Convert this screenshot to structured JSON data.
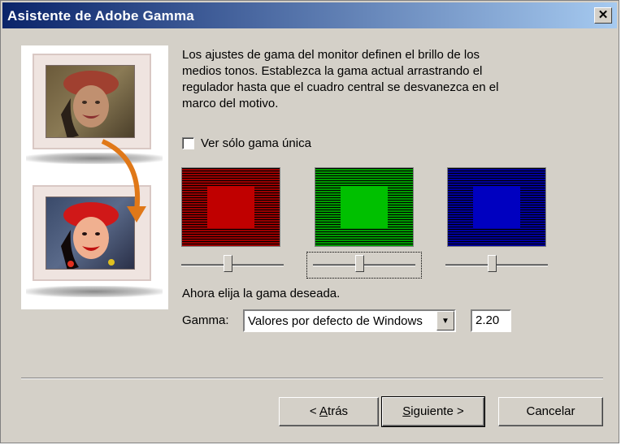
{
  "window": {
    "title": "Asistente de Adobe Gamma",
    "close_glyph": "✕"
  },
  "description": "Los ajustes de gama del monitor definen el brillo de los medios tonos. Establezca la gama actual arrastrando el regulador hasta que el cuadro central se desvanezca en el marco del motivo.",
  "single_gamma_checkbox": {
    "label": "Ver sólo gama única",
    "checked": false
  },
  "swatches": [
    {
      "name": "red",
      "frame_color": "#9a0000",
      "center_color": "#c00000"
    },
    {
      "name": "green",
      "frame_color": "#009a00",
      "center_color": "#00c000"
    },
    {
      "name": "blue",
      "frame_color": "#00009a",
      "center_color": "#0000c0"
    }
  ],
  "sliders": [
    {
      "channel": "red",
      "level": 0.45
    },
    {
      "channel": "green",
      "level": 0.45
    },
    {
      "channel": "blue",
      "level": 0.45
    }
  ],
  "prompt": "Ahora elija la gama deseada.",
  "gamma": {
    "label": "Gamma:",
    "selected": "Valores por defecto de Windows",
    "value": "2.20"
  },
  "buttons": {
    "back_prefix": "< ",
    "back_mnemonic": "A",
    "back_rest": "trás",
    "next_mnemonic": "S",
    "next_rest": "iguiente",
    "next_suffix": " >",
    "cancel": "Cancelar"
  }
}
